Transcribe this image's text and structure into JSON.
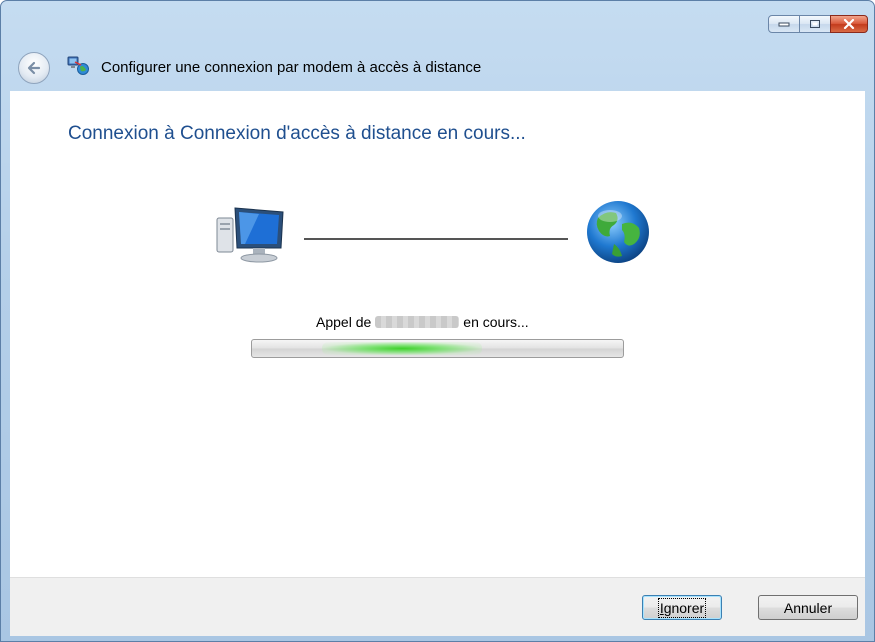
{
  "window": {
    "title": "Configurer une connexion par modem à accès à distance",
    "controls": {
      "minimize_icon": "minimize-icon",
      "maximize_icon": "maximize-icon",
      "close_icon": "close-icon"
    },
    "accent_color": "#1f4f8f"
  },
  "main": {
    "heading": "Connexion à Connexion d'accès à distance en cours...",
    "status_prefix": "Appel de",
    "status_suffix": "en cours...",
    "progress": {
      "state": "indeterminate",
      "color": "#3ed12b"
    }
  },
  "footer": {
    "ignore_first": "I",
    "ignore_rest": "gnorer",
    "cancel_label": "Annuler"
  }
}
